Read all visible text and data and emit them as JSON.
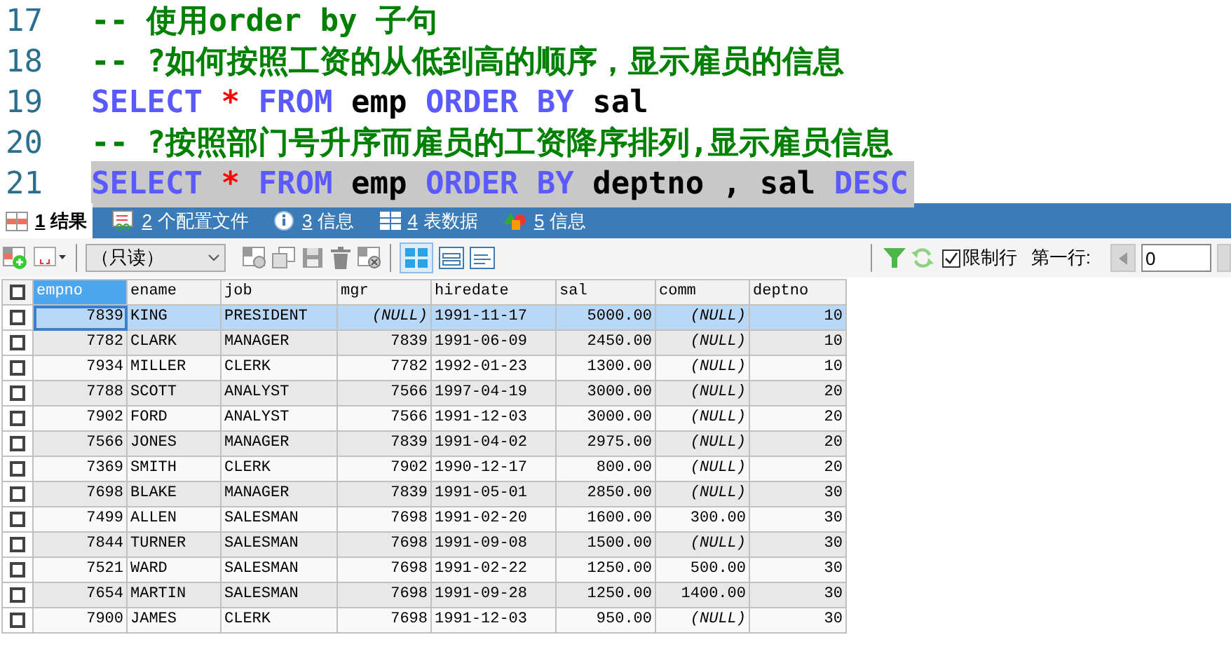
{
  "editor": {
    "lines": [
      {
        "number": "17",
        "selected": false,
        "tokens": [
          {
            "kind": "comment",
            "text": "-- 使用order by 子句"
          }
        ]
      },
      {
        "number": "18",
        "selected": false,
        "tokens": [
          {
            "kind": "comment",
            "text": "-- ?如何按照工资的从低到高的顺序，显示雇员的信息"
          }
        ]
      },
      {
        "number": "19",
        "selected": false,
        "tokens": [
          {
            "kind": "keyword",
            "text": "SELECT"
          },
          {
            "kind": "operator",
            "text": " * "
          },
          {
            "kind": "keyword",
            "text": "FROM"
          },
          {
            "kind": "identifier",
            "text": " emp "
          },
          {
            "kind": "keyword",
            "text": "ORDER BY"
          },
          {
            "kind": "identifier",
            "text": " sal"
          }
        ]
      },
      {
        "number": "20",
        "selected": false,
        "tokens": [
          {
            "kind": "comment",
            "text": "-- ?按照部门号升序而雇员的工资降序排列,显示雇员信息"
          }
        ]
      },
      {
        "number": "21",
        "selected": true,
        "tokens": [
          {
            "kind": "keyword",
            "text": "SELECT"
          },
          {
            "kind": "operator",
            "text": " * "
          },
          {
            "kind": "keyword",
            "text": "FROM"
          },
          {
            "kind": "identifier",
            "text": " emp "
          },
          {
            "kind": "keyword",
            "text": "ORDER BY"
          },
          {
            "kind": "identifier",
            "text": " deptno , sal "
          },
          {
            "kind": "keyword",
            "text": "DESC"
          }
        ]
      }
    ]
  },
  "tabs": [
    {
      "key": "1",
      "label": "结果",
      "kind": "grid",
      "selected": true
    },
    {
      "key": "2",
      "label": "个配置文件",
      "kind": "profile",
      "selected": false
    },
    {
      "key": "3",
      "label": "信息",
      "kind": "info",
      "selected": false
    },
    {
      "key": "4",
      "label": "表数据",
      "kind": "table",
      "selected": false
    },
    {
      "key": "5",
      "label": "信息",
      "kind": "shapes",
      "selected": false
    }
  ],
  "toolbar": {
    "mode_dropdown": {
      "value": "（只读）"
    },
    "limit_rows": {
      "label": "限制行",
      "checked": true
    },
    "first_row": {
      "label": "第一行:",
      "value": "0"
    }
  },
  "table": {
    "select_all_checked": false,
    "columns": [
      {
        "name": "empno",
        "kind": "number",
        "selected": true
      },
      {
        "name": "ename",
        "kind": "text",
        "selected": false
      },
      {
        "name": "job",
        "kind": "text",
        "selected": false
      },
      {
        "name": "mgr",
        "kind": "number",
        "selected": false
      },
      {
        "name": "hiredate",
        "kind": "text",
        "selected": false
      },
      {
        "name": "sal",
        "kind": "number",
        "selected": false
      },
      {
        "name": "comm",
        "kind": "number",
        "selected": false
      },
      {
        "name": "deptno",
        "kind": "number",
        "selected": false
      }
    ],
    "rows": [
      {
        "selected": true,
        "checked": false,
        "cells": [
          "7839",
          "KING",
          "PRESIDENT",
          "(NULL)",
          "1991-11-17",
          "5000.00",
          "(NULL)",
          "10"
        ]
      },
      {
        "selected": false,
        "checked": false,
        "cells": [
          "7782",
          "CLARK",
          "MANAGER",
          "7839",
          "1991-06-09",
          "2450.00",
          "(NULL)",
          "10"
        ]
      },
      {
        "selected": false,
        "checked": false,
        "cells": [
          "7934",
          "MILLER",
          "CLERK",
          "7782",
          "1992-01-23",
          "1300.00",
          "(NULL)",
          "10"
        ]
      },
      {
        "selected": false,
        "checked": false,
        "cells": [
          "7788",
          "SCOTT",
          "ANALYST",
          "7566",
          "1997-04-19",
          "3000.00",
          "(NULL)",
          "20"
        ]
      },
      {
        "selected": false,
        "checked": false,
        "cells": [
          "7902",
          "FORD",
          "ANALYST",
          "7566",
          "1991-12-03",
          "3000.00",
          "(NULL)",
          "20"
        ]
      },
      {
        "selected": false,
        "checked": false,
        "cells": [
          "7566",
          "JONES",
          "MANAGER",
          "7839",
          "1991-04-02",
          "2975.00",
          "(NULL)",
          "20"
        ]
      },
      {
        "selected": false,
        "checked": false,
        "cells": [
          "7369",
          "SMITH",
          "CLERK",
          "7902",
          "1990-12-17",
          "800.00",
          "(NULL)",
          "20"
        ]
      },
      {
        "selected": false,
        "checked": false,
        "cells": [
          "7698",
          "BLAKE",
          "MANAGER",
          "7839",
          "1991-05-01",
          "2850.00",
          "(NULL)",
          "30"
        ]
      },
      {
        "selected": false,
        "checked": false,
        "cells": [
          "7499",
          "ALLEN",
          "SALESMAN",
          "7698",
          "1991-02-20",
          "1600.00",
          "300.00",
          "30"
        ]
      },
      {
        "selected": false,
        "checked": false,
        "cells": [
          "7844",
          "TURNER",
          "SALESMAN",
          "7698",
          "1991-09-08",
          "1500.00",
          "(NULL)",
          "30"
        ]
      },
      {
        "selected": false,
        "checked": false,
        "cells": [
          "7521",
          "WARD",
          "SALESMAN",
          "7698",
          "1991-02-22",
          "1250.00",
          "500.00",
          "30"
        ]
      },
      {
        "selected": false,
        "checked": false,
        "cells": [
          "7654",
          "MARTIN",
          "SALESMAN",
          "7698",
          "1991-09-28",
          "1250.00",
          "1400.00",
          "30"
        ]
      },
      {
        "selected": false,
        "checked": false,
        "cells": [
          "7900",
          "JAMES",
          "CLERK",
          "7698",
          "1991-12-03",
          "950.00",
          "(NULL)",
          "30"
        ]
      }
    ]
  }
}
